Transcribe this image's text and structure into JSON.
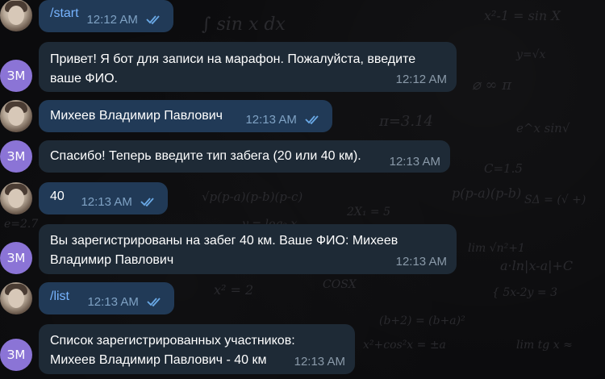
{
  "messages": [
    {
      "sender": "user",
      "text": "/start",
      "time": "12:12 AM",
      "read": true
    },
    {
      "sender": "bot",
      "avatar": "ЗМ",
      "lines": [
        "Привет! Я бот для записи на марафон. Пожалуйста, введите",
        "ваше ФИО."
      ],
      "time": "12:12 AM"
    },
    {
      "sender": "user",
      "text": "Михеев Владимир Павлович",
      "time": "12:13 AM",
      "read": true
    },
    {
      "sender": "bot",
      "avatar": "ЗМ",
      "lines": [
        "Спасибо! Теперь введите тип забега (20 или 40 км)."
      ],
      "time": "12:13 AM"
    },
    {
      "sender": "user",
      "text": "40",
      "time": "12:13 AM",
      "read": true
    },
    {
      "sender": "bot",
      "avatar": "ЗМ",
      "lines": [
        "Вы зарегистрированы на забег 40 км. Ваше ФИО: Михеев",
        "Владимир Павлович"
      ],
      "time": "12:13 AM"
    },
    {
      "sender": "user",
      "text": "/list",
      "time": "12:13 AM",
      "read": true
    },
    {
      "sender": "bot",
      "avatar": "ЗМ",
      "lines": [
        "Список зарегистрированных участников:",
        "Михеев Владимир Павлович - 40 км"
      ],
      "time": "12:13 AM"
    }
  ],
  "colors": {
    "bot_bubble": "#1e2a36",
    "user_bubble": "#213a57",
    "link": "#77b4ff",
    "avatar_bg": "#8b74d6",
    "check": "#6aa9e6"
  }
}
